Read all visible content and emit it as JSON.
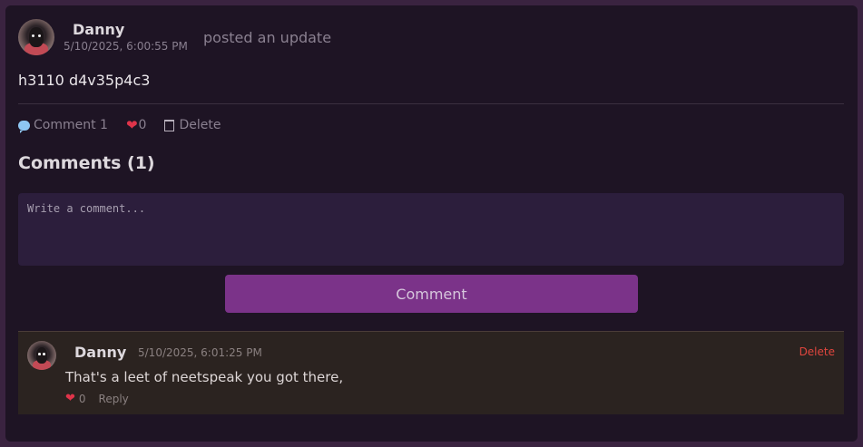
{
  "post": {
    "author": "Danny",
    "timestamp": "5/10/2025, 6:00:55 PM",
    "action": "posted an update",
    "body": "h3110 d4v35p4c3",
    "actions": {
      "comment_label": "Comment 1",
      "like_count": "0",
      "delete_label": "Delete"
    }
  },
  "comments_section": {
    "heading": "Comments (1)",
    "input_placeholder": "Write a comment...",
    "submit_label": "Comment",
    "items": [
      {
        "author": "Danny",
        "timestamp": "5/10/2025, 6:01:25 PM",
        "delete_label": "Delete",
        "body": "That's a leet of neetspeak you got there,",
        "like_count": "0",
        "reply_label": "Reply"
      }
    ]
  },
  "colors": {
    "accent": "#7b3389",
    "heart": "#e0344a",
    "delete": "#e0463e",
    "background": "#1e1424"
  },
  "icons": [
    "comment-bubble-icon",
    "heart-icon",
    "trash-icon"
  ]
}
